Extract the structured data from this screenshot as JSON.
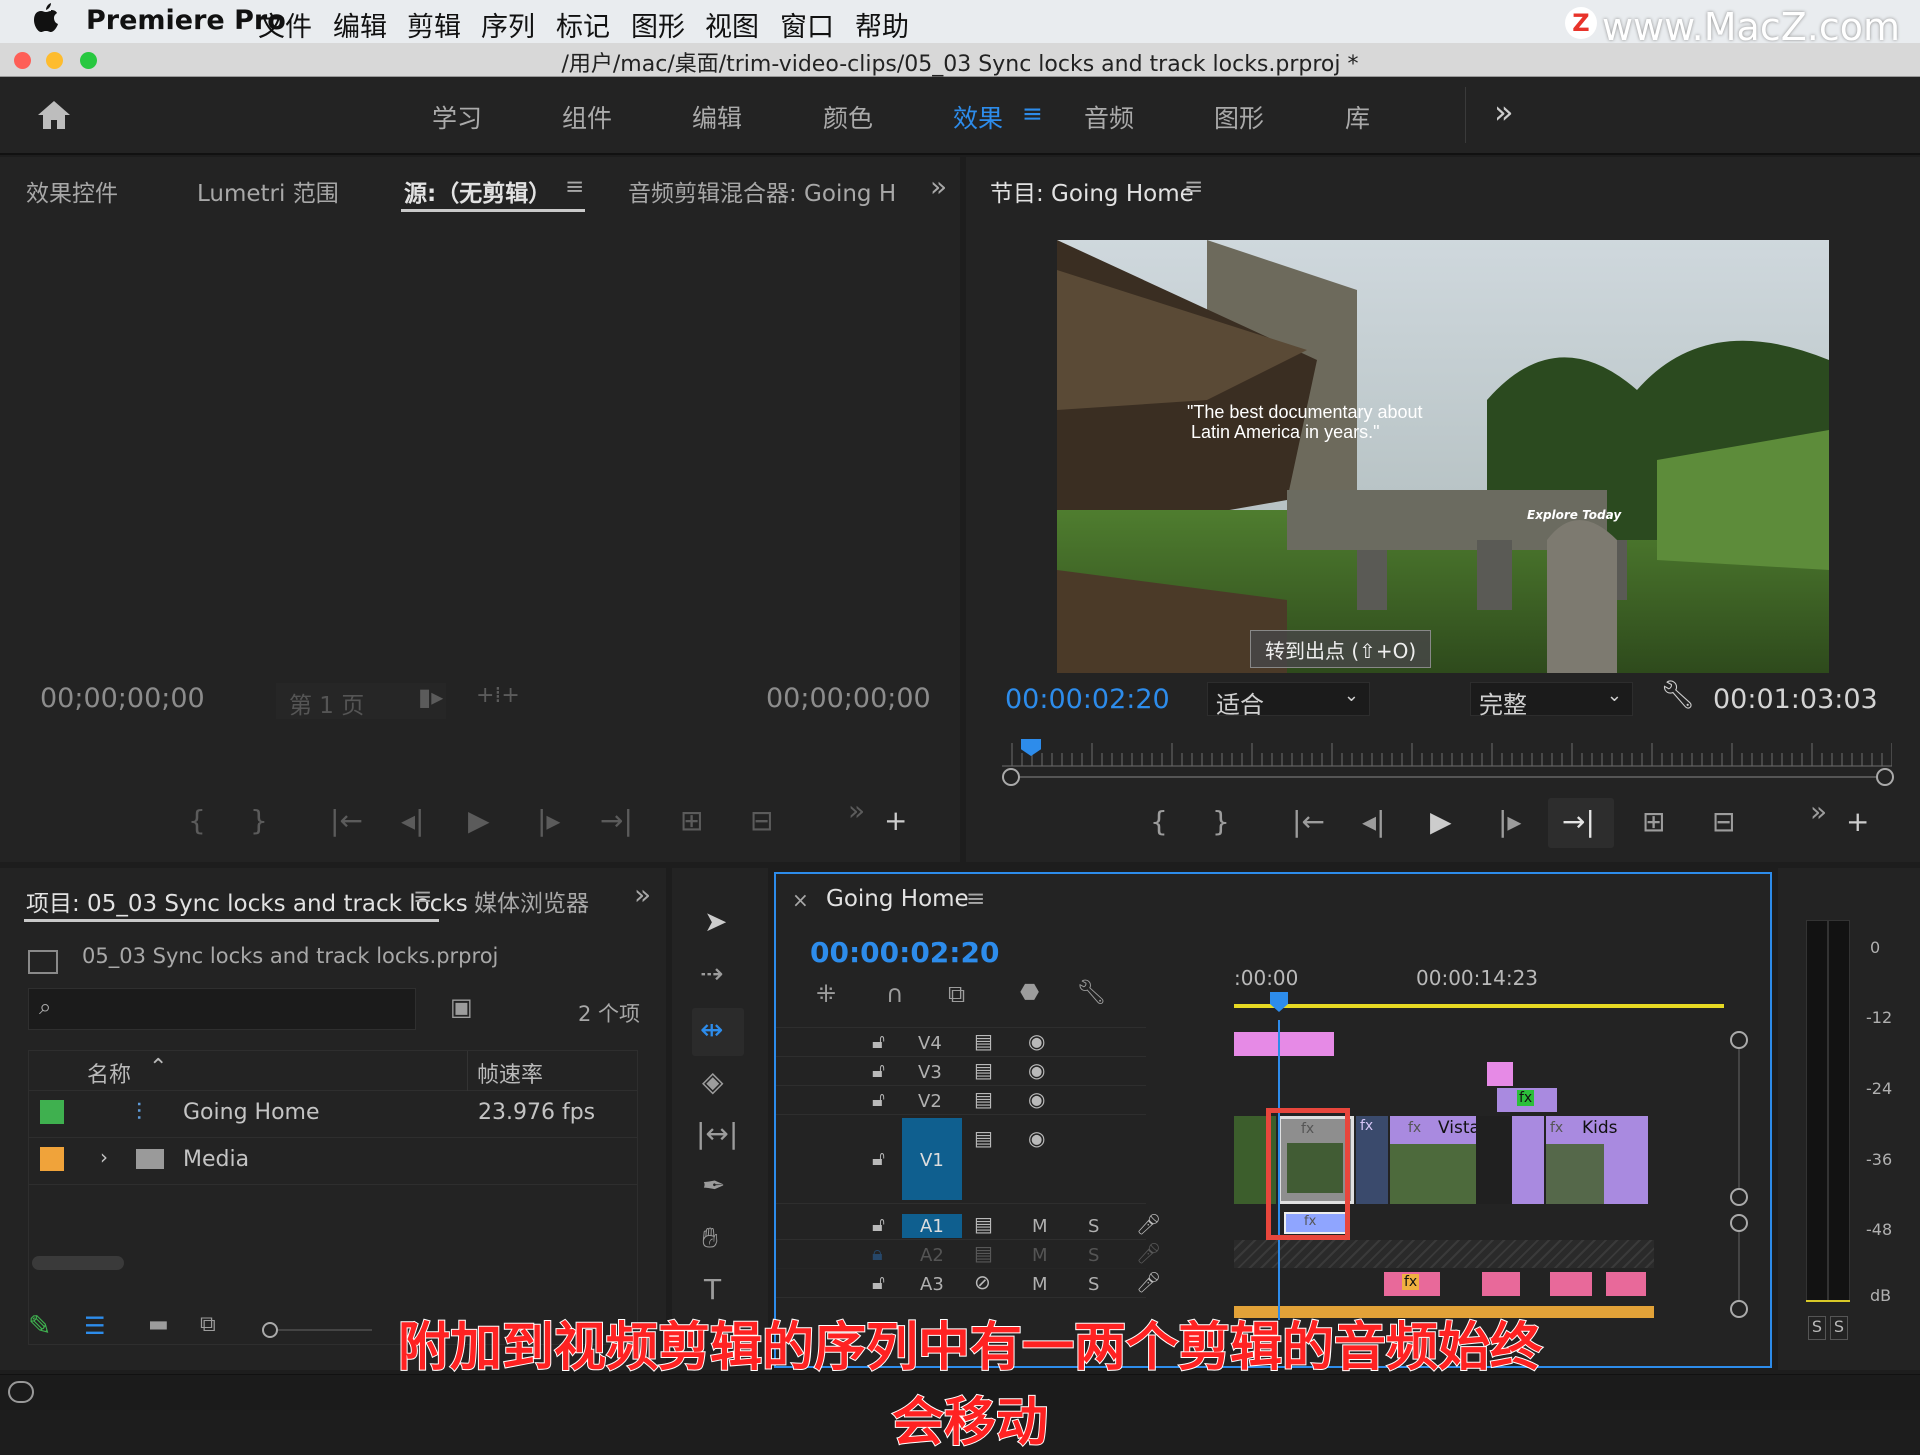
{
  "menubar": {
    "app_name": "Premiere Pro",
    "items": [
      "文件",
      "编辑",
      "剪辑",
      "序列",
      "标记",
      "图形",
      "视图",
      "窗口",
      "帮助"
    ],
    "watermark": "www.MacZ.com",
    "watermark_logo": "Z"
  },
  "window": {
    "title": "/用户/mac/桌面/trim-video-clips/05_03 Sync locks and track locks.prproj *"
  },
  "workspaces": {
    "items": [
      "学习",
      "组件",
      "编辑",
      "颜色",
      "效果",
      "音频",
      "图形",
      "库"
    ],
    "active": "效果",
    "menu_glyph": "≡",
    "more_glyph": "»"
  },
  "source_panel": {
    "tabs": [
      "效果控件",
      "Lumetri 范围",
      "源:（无剪辑）",
      "音频剪辑混合器: Going H"
    ],
    "active_tab": "源:（无剪辑）",
    "timecode_left": "00;00;00;00",
    "page_label": "第 1 页",
    "timecode_right": "00;00;00;00"
  },
  "program_panel": {
    "tab": "节目: Going Home",
    "video_quote_line1": "\"The best documentary about",
    "video_quote_line2": "Latin America in years.\"",
    "video_tagline": "Explore Today",
    "tooltip": "转到出点 (⇧+O)",
    "timecode": "00:00:02:20",
    "fit": "适合",
    "quality": "完整",
    "duration": "00:01:03:03"
  },
  "project_panel": {
    "tab": "项目: 05_03 Sync locks and track locks",
    "tab2": "媒体浏览器",
    "project_file": "05_03 Sync locks and track locks.prproj",
    "item_count": "2 个项",
    "search_placeholder": "",
    "col_name": "名称",
    "col_fps": "帧速率",
    "items": [
      {
        "name": "Going Home",
        "fps": "23.976 fps",
        "color": "#3fb04f"
      },
      {
        "name": "Media",
        "fps": "",
        "color": "#f0a33a"
      }
    ]
  },
  "timeline": {
    "tab": "Going Home",
    "timecode": "00:00:02:20",
    "ruler_start": ":00:00",
    "ruler_mid": "00:00:14:23",
    "tracks_video": [
      "V4",
      "V3",
      "V2",
      "V1"
    ],
    "tracks_audio": [
      "A1",
      "A2",
      "A3"
    ],
    "mute": "M",
    "solo": "S",
    "clip_labels": [
      "Vista",
      "Kids"
    ],
    "fx": "fx"
  },
  "meter": {
    "scale": [
      "0",
      "-12",
      "-24",
      "-36",
      "-48",
      "dB"
    ],
    "solo_labels": [
      "S",
      "S"
    ]
  },
  "caption": "附加到视频剪辑的序列中有一两个剪辑的音频始终会移动",
  "colors": {
    "accent": "#2d8ceb",
    "video_clip": "#a98ae0",
    "audio_clip": "#e8699a",
    "highlight_box": "#e8463c"
  }
}
